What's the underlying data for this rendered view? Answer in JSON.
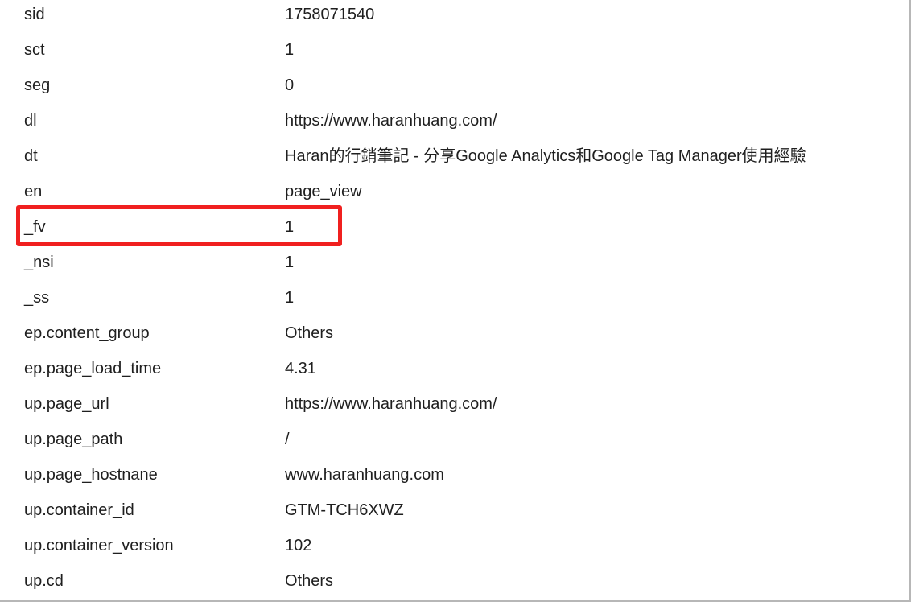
{
  "params": [
    {
      "key": "sid",
      "value": "1758071540"
    },
    {
      "key": "sct",
      "value": "1"
    },
    {
      "key": "seg",
      "value": "0"
    },
    {
      "key": "dl",
      "value": "https://www.haranhuang.com/"
    },
    {
      "key": "dt",
      "value": "Haran的行銷筆記 - 分享Google Analytics和Google Tag Manager使用經驗"
    },
    {
      "key": "en",
      "value": "page_view"
    },
    {
      "key": "_fv",
      "value": "1"
    },
    {
      "key": "_nsi",
      "value": "1"
    },
    {
      "key": "_ss",
      "value": "1"
    },
    {
      "key": "ep.content_group",
      "value": "Others"
    },
    {
      "key": "ep.page_load_time",
      "value": "4.31"
    },
    {
      "key": "up.page_url",
      "value": "https://www.haranhuang.com/"
    },
    {
      "key": "up.page_path",
      "value": "/"
    },
    {
      "key": "up.page_hostnane",
      "value": "www.haranhuang.com"
    },
    {
      "key": "up.container_id",
      "value": "GTM-TCH6XWZ"
    },
    {
      "key": "up.container_version",
      "value": "102"
    },
    {
      "key": "up.cd",
      "value": "Others"
    }
  ],
  "highlight_color": "#f0201f"
}
